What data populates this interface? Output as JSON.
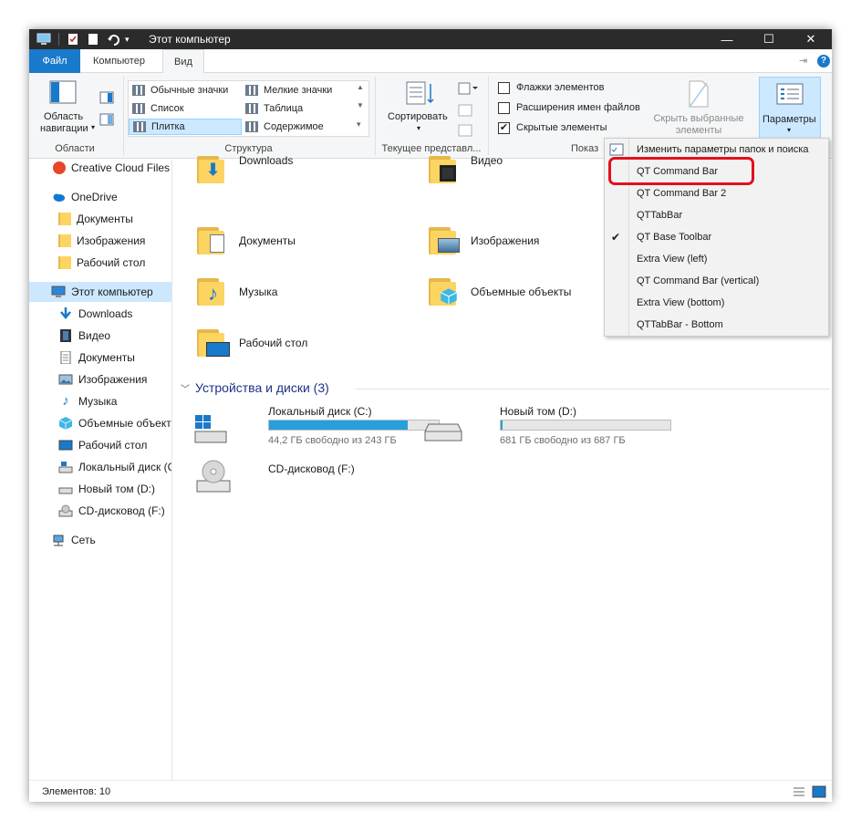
{
  "window": {
    "title": "Этот компьютер",
    "controls": {
      "minimize": "—",
      "maximize": "☐",
      "close": "✕"
    }
  },
  "tabs": [
    {
      "label": "Файл"
    },
    {
      "label": "Компьютер"
    },
    {
      "label": "Вид"
    }
  ],
  "ribbon": {
    "nav_area_line1": "Область",
    "nav_area_line2": "навигации",
    "group_areas": "Области",
    "layouts": [
      "Обычные значки",
      "Мелкие значки",
      "Список",
      "Таблица",
      "Плитка",
      "Содержимое"
    ],
    "selected_layout": "Плитка",
    "group_layout": "Структура",
    "sort_label": "Сортировать",
    "group_current_view": "Текущее представл...",
    "checkboxes": [
      {
        "label": "Флажки элементов",
        "checked": false
      },
      {
        "label": "Расширения имен файлов",
        "checked": false
      },
      {
        "label": "Скрытые элементы",
        "checked": true
      }
    ],
    "hide_selected_line1": "Скрыть выбранные",
    "hide_selected_line2": "элементы",
    "group_show_hide": "Показ",
    "params_label": "Параметры"
  },
  "nav": {
    "items": [
      {
        "label": "Creative Cloud Files",
        "icon": "creative-cloud-icon"
      },
      {
        "label": "OneDrive",
        "icon": "cloud-icon"
      },
      {
        "label": "Документы",
        "icon": "folder-icon"
      },
      {
        "label": "Изображения",
        "icon": "folder-icon"
      },
      {
        "label": "Рабочий стол",
        "icon": "folder-icon"
      },
      {
        "label": "Этот компьютер",
        "icon": "computer-icon",
        "selected": true
      },
      {
        "label": "Downloads",
        "icon": "download-arrow-icon"
      },
      {
        "label": "Видео",
        "icon": "video-icon"
      },
      {
        "label": "Документы",
        "icon": "document-icon"
      },
      {
        "label": "Изображения",
        "icon": "picture-icon"
      },
      {
        "label": "Музыка",
        "icon": "music-icon"
      },
      {
        "label": "Объемные объект",
        "icon": "cube-icon"
      },
      {
        "label": "Рабочий стол",
        "icon": "desktop-icon"
      },
      {
        "label": "Локальный диск (С",
        "icon": "drive-icon"
      },
      {
        "label": "Новый том (D:)",
        "icon": "drive-icon"
      },
      {
        "label": "CD-дисковод (F:)",
        "icon": "cd-drive-icon"
      },
      {
        "label": "Сеть",
        "icon": "network-icon"
      }
    ]
  },
  "content": {
    "folders": [
      {
        "label": "Downloads",
        "icon": "download-arrow-icon"
      },
      {
        "label": "Видео",
        "icon": "video-icon"
      },
      {
        "label": "Документы",
        "icon": "document-icon"
      },
      {
        "label": "Изображения",
        "icon": "picture-icon"
      },
      {
        "label": "Музыка",
        "icon": "music-icon"
      },
      {
        "label": "Объемные объекты",
        "icon": "cube-icon"
      },
      {
        "label": "Рабочий стол",
        "icon": "desktop-icon"
      }
    ],
    "devices_header": "Устройства и диски (3)",
    "drives": [
      {
        "label": "Локальный диск (C:)",
        "free": "44,2 ГБ свободно из 243 ГБ",
        "used_fraction": 0.818
      },
      {
        "label": "Новый том (D:)",
        "free": "681 ГБ свободно из 687 ГБ",
        "used_fraction": 0.009
      },
      {
        "label": "CD-дисковод (F:)"
      }
    ]
  },
  "dropdown": {
    "items": [
      {
        "label": "Изменить параметры папок и поиска",
        "checked": false
      },
      {
        "label": "QT Command Bar",
        "checked": false,
        "highlighted": true
      },
      {
        "label": "QT Command Bar 2",
        "checked": false
      },
      {
        "label": "QTTabBar",
        "checked": false
      },
      {
        "label": "QT Base Toolbar",
        "checked": true
      },
      {
        "label": "Extra View (left)",
        "checked": false
      },
      {
        "label": "QT Command Bar (vertical)",
        "checked": false
      },
      {
        "label": "Extra View (bottom)",
        "checked": false
      },
      {
        "label": "QTTabBar - Bottom",
        "checked": false
      }
    ],
    "check_mark": "✔"
  },
  "status": {
    "items_count": "Элементов: 10"
  },
  "colors": {
    "accent": "#1979ca",
    "selection": "#cce8ff",
    "highlight_ring": "#e3101e",
    "drive_fill": "#26a0da"
  }
}
